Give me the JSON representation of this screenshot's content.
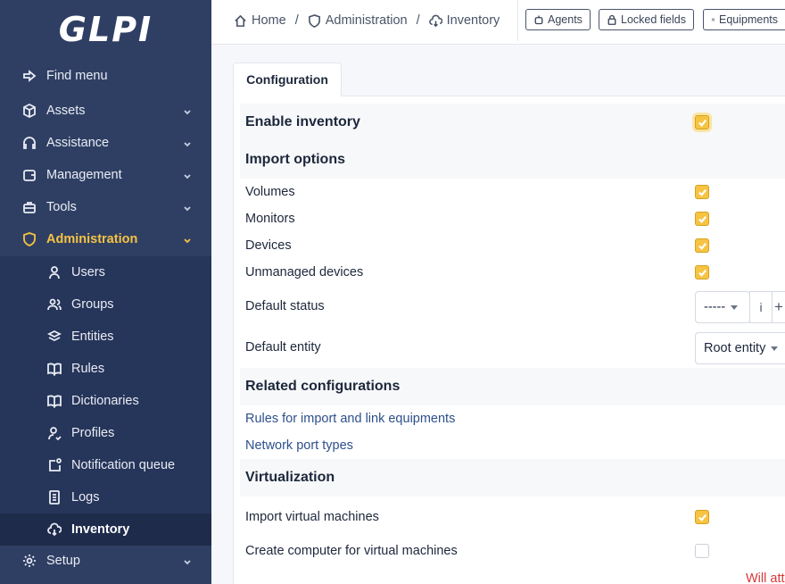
{
  "app": {
    "logo_text": "GLPI"
  },
  "sidebar": {
    "items": [
      {
        "label": "Find menu",
        "icon": "arrow-right-icon"
      },
      {
        "label": "Assets",
        "icon": "box-icon"
      },
      {
        "label": "Assistance",
        "icon": "headset-icon"
      },
      {
        "label": "Management",
        "icon": "wallet-icon"
      },
      {
        "label": "Tools",
        "icon": "briefcase-icon"
      },
      {
        "label": "Administration",
        "icon": "shield-icon"
      },
      {
        "label": "Setup",
        "icon": "gear-icon"
      }
    ],
    "submenu": [
      {
        "label": "Users",
        "icon": "user-icon"
      },
      {
        "label": "Groups",
        "icon": "users-icon"
      },
      {
        "label": "Entities",
        "icon": "stack-icon"
      },
      {
        "label": "Rules",
        "icon": "book-icon"
      },
      {
        "label": "Dictionaries",
        "icon": "book-icon"
      },
      {
        "label": "Profiles",
        "icon": "user-check-icon"
      },
      {
        "label": "Notification queue",
        "icon": "notification-icon"
      },
      {
        "label": "Logs",
        "icon": "log-icon"
      },
      {
        "label": "Inventory",
        "icon": "cloud-download-icon"
      }
    ]
  },
  "breadcrumb": {
    "home": "Home",
    "admin": "Administration",
    "inventory": "Inventory",
    "sep": "/"
  },
  "header_buttons": {
    "agents": "Agents",
    "locked": "Locked fields",
    "equipments": "Equipments"
  },
  "tab": {
    "label": "Configuration"
  },
  "form": {
    "enable_inventory": "Enable inventory",
    "import_options": "Import options",
    "volumes": "Volumes",
    "monitors": "Monitors",
    "devices": "Devices",
    "unmanaged": "Unmanaged devices",
    "default_status": "Default status",
    "default_status_value": "-----",
    "info_glyph": "i",
    "plus_glyph": "+",
    "default_entity": "Default entity",
    "default_entity_value": "Root entity",
    "related": "Related configurations",
    "rules_link": "Rules for import and link equipments",
    "netport_link": "Network port types",
    "virtualization": "Virtualization",
    "import_vm": "Import virtual machines",
    "create_computer_vm": "Create computer for virtual machines",
    "warning_text": "Will att"
  },
  "colors": {
    "sidebar_bg": "#2f3f64",
    "accent": "#f6c343",
    "link": "#2e4f8c",
    "danger": "#d63939"
  }
}
